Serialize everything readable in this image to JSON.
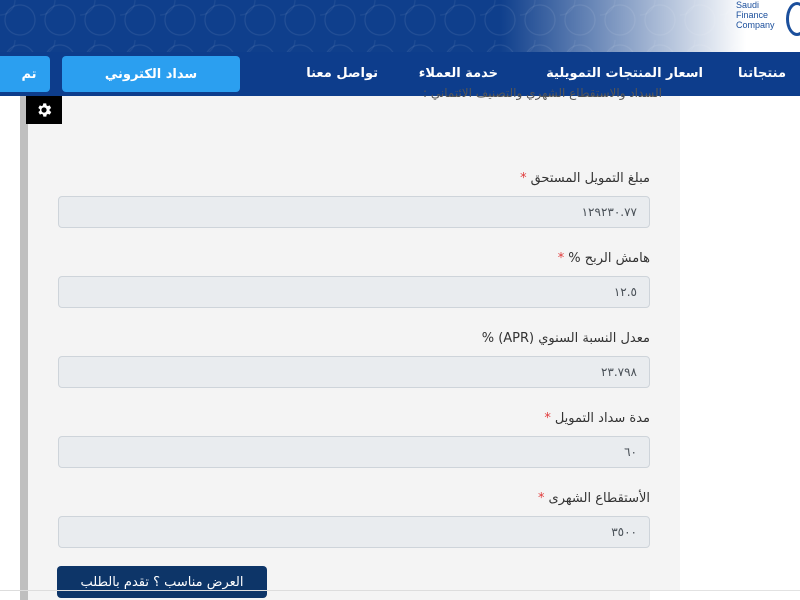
{
  "brand": {
    "logo_lines": [
      "Saudi",
      "Finance",
      "Company"
    ],
    "primary_color": "#0d3d8c",
    "accent_color": "#2b9ff0"
  },
  "nav": {
    "items": [
      "منتجاتنا",
      "اسعار المنتجات التمويلية",
      "خدمة العملاء",
      "تواصل معنا"
    ],
    "pay_button": "سداد الكتروني",
    "cut_button": "تم"
  },
  "intro_text": "السداد والاستقطاع الشهري والتصنيف الائتماني :",
  "fields": [
    {
      "label": "مبلغ التمويل المستحق",
      "required": true,
      "value": "١٢٩٢٣٠.٧٧"
    },
    {
      "label": "هامش الربح %",
      "required": true,
      "value": "١٢.٥"
    },
    {
      "label": "معدل النسبة السنوي (APR) %",
      "required": false,
      "value": "٢٣.٧٩٨"
    },
    {
      "label": "مدة سداد التمويل",
      "required": true,
      "value": "٦٠"
    },
    {
      "label": "الأستقطاع الشهرى",
      "required": true,
      "value": "٣٥٠٠"
    }
  ],
  "submit_label": "العرض مناسب ؟ تقدم بالطلب",
  "icons": {
    "settings": "gear-icon"
  }
}
